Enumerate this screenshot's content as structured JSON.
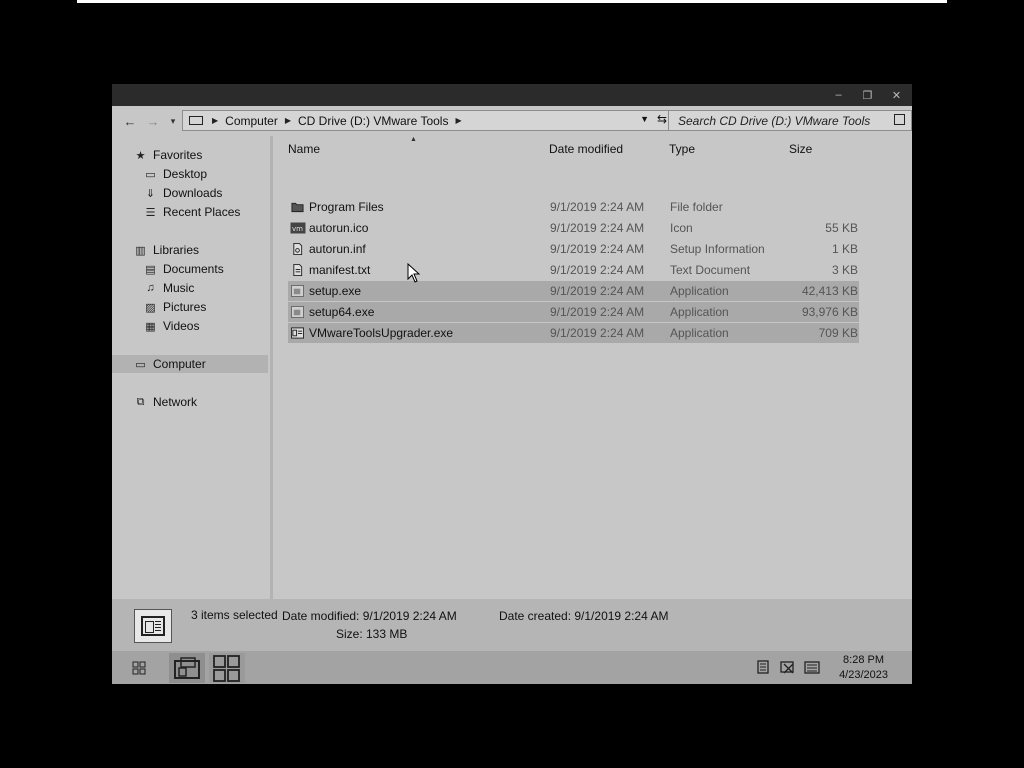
{
  "window": {
    "controls": {
      "minimize": "–",
      "restore": "❐",
      "close": "✕"
    }
  },
  "toolbar": {
    "back_icon": "←",
    "forward_icon": "→",
    "recent_icon": "▾",
    "breadcrumbs": [
      "Computer",
      "CD Drive (D:) VMware Tools"
    ],
    "search_placeholder": "Search CD Drive (D:) VMware Tools"
  },
  "sidebar": {
    "favorites": {
      "label": "Favorites",
      "items": [
        "Desktop",
        "Downloads",
        "Recent Places"
      ]
    },
    "libraries": {
      "label": "Libraries",
      "items": [
        "Documents",
        "Music",
        "Pictures",
        "Videos"
      ]
    },
    "computer": "Computer",
    "network": "Network"
  },
  "columns": {
    "name": "Name",
    "date": "Date modified",
    "type": "Type",
    "size": "Size"
  },
  "files": [
    {
      "name": "Program Files",
      "date": "9/1/2019 2:24 AM",
      "type": "File folder",
      "size": "",
      "icon": "folder-icon",
      "selected": false
    },
    {
      "name": "autorun.ico",
      "date": "9/1/2019 2:24 AM",
      "type": "Icon",
      "size": "55 KB",
      "icon": "vm-icon",
      "selected": false
    },
    {
      "name": "autorun.inf",
      "date": "9/1/2019 2:24 AM",
      "type": "Setup Information",
      "size": "1 KB",
      "icon": "settings-file-icon",
      "selected": false
    },
    {
      "name": "manifest.txt",
      "date": "9/1/2019 2:24 AM",
      "type": "Text Document",
      "size": "3 KB",
      "icon": "text-file-icon",
      "selected": false
    },
    {
      "name": "setup.exe",
      "date": "9/1/2019 2:24 AM",
      "type": "Application",
      "size": "42,413 KB",
      "icon": "installer-icon",
      "selected": true
    },
    {
      "name": "setup64.exe",
      "date": "9/1/2019 2:24 AM",
      "type": "Application",
      "size": "93,976 KB",
      "icon": "installer-icon",
      "selected": true
    },
    {
      "name": "VMwareToolsUpgrader.exe",
      "date": "9/1/2019 2:24 AM",
      "type": "Application",
      "size": "709 KB",
      "icon": "app-window-icon",
      "selected": true
    }
  ],
  "status": {
    "selected": "3 items selected",
    "date_modified": "Date modified: 9/1/2019 2:24 AM",
    "date_created": "Date created: 9/1/2019 2:24 AM",
    "size": "Size: 133 MB"
  },
  "taskbar": {
    "time": "8:28 PM",
    "date": "4/23/2023"
  }
}
